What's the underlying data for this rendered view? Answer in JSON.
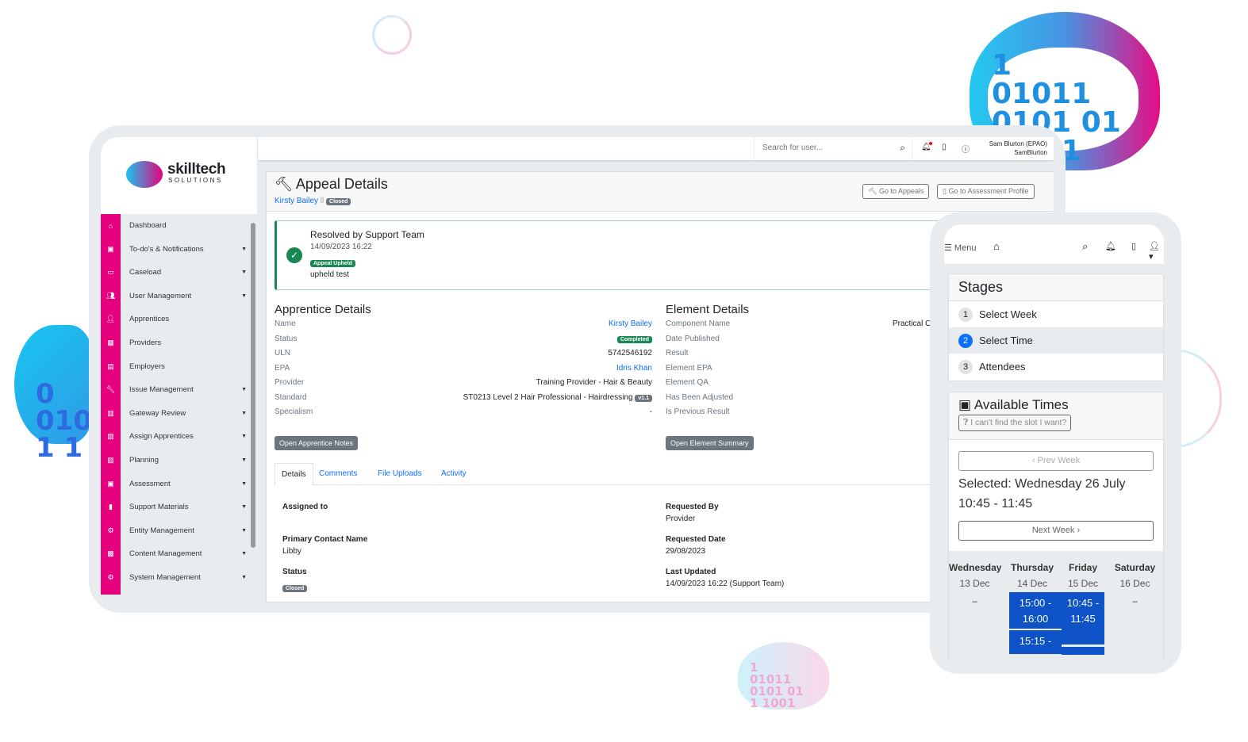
{
  "decor": {
    "cloud_digits_large": "1\n01011\n0101 01\n     01",
    "cloud_digits_left": "0\n010\n1 1",
    "cloud_digits_small": "1\n01011\n0101 01\n1 1001"
  },
  "brand": {
    "name": "skilltech",
    "tagline": "SOLUTIONS",
    "accent": "#e6007e"
  },
  "sidebar": {
    "items": [
      {
        "label": "Dashboard",
        "icon": "home-icon",
        "dropdown": false
      },
      {
        "label": "To-do's & Notifications",
        "icon": "clipboard-check-icon",
        "dropdown": true
      },
      {
        "label": "Caseload",
        "icon": "archive-icon",
        "dropdown": true
      },
      {
        "label": "User Management",
        "icon": "users-icon",
        "dropdown": true
      },
      {
        "label": "Apprentices",
        "icon": "user-icon",
        "dropdown": false
      },
      {
        "label": "Providers",
        "icon": "book-open-icon",
        "dropdown": false
      },
      {
        "label": "Employers",
        "icon": "briefcase-icon",
        "dropdown": false
      },
      {
        "label": "Issue Management",
        "icon": "wrench-icon",
        "dropdown": true
      },
      {
        "label": "Gateway Review",
        "icon": "archway-icon",
        "dropdown": true
      },
      {
        "label": "Assign Apprentices",
        "icon": "chalkboard-user-icon",
        "dropdown": true
      },
      {
        "label": "Planning",
        "icon": "map-icon",
        "dropdown": true
      },
      {
        "label": "Assessment",
        "icon": "clipboard-user-icon",
        "dropdown": true
      },
      {
        "label": "Support Materials",
        "icon": "file-icon",
        "dropdown": true
      },
      {
        "label": "Entity Management",
        "icon": "gear-icon",
        "dropdown": true
      },
      {
        "label": "Content Management",
        "icon": "photo-film-icon",
        "dropdown": true
      },
      {
        "label": "System Management",
        "icon": "gears-icon",
        "dropdown": true
      }
    ]
  },
  "topbar": {
    "search_placeholder": "Search for user...",
    "user_name": "Sam Blurton (EPAO)",
    "user_login": "SamBlurton"
  },
  "header": {
    "title": "Appeal Details",
    "person": "Kirsty Bailey",
    "status": "Closed",
    "go_appeals": "Go to Appeals",
    "go_profile": "Go to Assessment Profile"
  },
  "resolution": {
    "title": "Resolved by Support Team",
    "date": "14/09/2023 16:22",
    "badge": "Appeal Upheld",
    "note": "upheld test"
  },
  "apprentice": {
    "heading": "Apprentice Details",
    "rows": [
      {
        "label": "Name",
        "value": "Kirsty Bailey"
      },
      {
        "label": "Status",
        "value": "Completed"
      },
      {
        "label": "ULN",
        "value": "5742546192"
      },
      {
        "label": "EPA",
        "value": "Idris Khan"
      },
      {
        "label": "Provider",
        "value": "Training Provider - Hair & Beauty"
      },
      {
        "label": "Standard",
        "value": "ST0213 Level 2 Hair Professional - Hairdressing",
        "version": "v1.1"
      },
      {
        "label": "Specialism",
        "value": "-"
      }
    ],
    "button": "Open Apprentice Notes"
  },
  "element": {
    "heading": "Element Details",
    "rows": [
      {
        "label": "Component Name",
        "value": "Practical O"
      },
      {
        "label": "Date Published"
      },
      {
        "label": "Result"
      },
      {
        "label": "Element EPA"
      },
      {
        "label": "Element QA"
      },
      {
        "label": "Has Been Adjusted"
      },
      {
        "label": "Is Previous Result"
      }
    ],
    "button": "Open Element Summary"
  },
  "tabs": [
    {
      "label": "Details",
      "active": true
    },
    {
      "label": "Comments"
    },
    {
      "label": "File Uploads"
    },
    {
      "label": "Activity"
    }
  ],
  "details": {
    "assigned_to": "Assigned to",
    "primary_contact_label": "Primary Contact Name",
    "primary_contact": "Libby",
    "status_label": "Status",
    "status": "Closed",
    "requested_by_label": "Requested By",
    "requested_by": "Provider",
    "requested_date_label": "Requested Date",
    "requested_date": "29/08/2023",
    "last_updated_label": "Last Updated",
    "last_updated": "14/09/2023 16:22 (Support Team)"
  },
  "mobile": {
    "menu": "Menu",
    "stages_title": "Stages",
    "stages": [
      {
        "n": "1",
        "label": "Select Week"
      },
      {
        "n": "2",
        "label": "Select Time",
        "active": true
      },
      {
        "n": "3",
        "label": "Attendees"
      }
    ],
    "available_title": "Available Times",
    "cant_find": "I can't find the slot I want?",
    "prev_week": "Prev Week",
    "next_week": "Next Week",
    "selected": "Selected: Wednesday 26 July",
    "selected_time": "10:45 - 11:45",
    "days": [
      {
        "name": "Wednesday",
        "date": "13 Dec",
        "empty": "–"
      },
      {
        "name": "Thursday",
        "date": "14 Dec",
        "slots": [
          "15:00 - 16:00",
          "15:15 -"
        ]
      },
      {
        "name": "Friday",
        "date": "15 Dec",
        "slots": [
          "10:45 - 11:45"
        ]
      },
      {
        "name": "Saturday",
        "date": "16 Dec",
        "empty": "–"
      }
    ]
  }
}
